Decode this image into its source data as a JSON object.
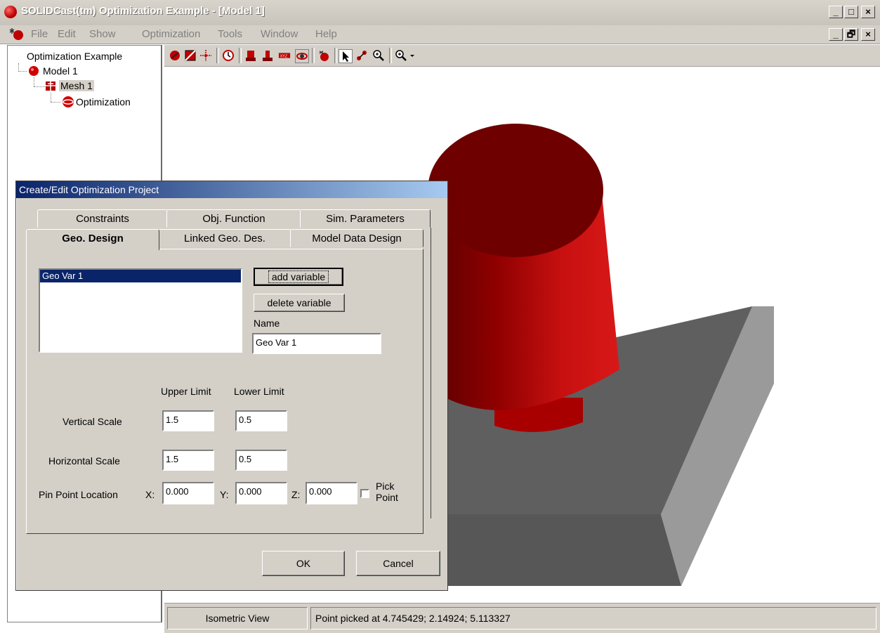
{
  "window": {
    "title": "SOLIDCast(tm) Optimization Example - [Model 1]",
    "controls": [
      "_",
      "□",
      "×"
    ],
    "child_controls": [
      "_",
      "🗗",
      "×"
    ]
  },
  "menu": [
    "File",
    "Edit",
    "Show",
    "Optimization",
    "Tools",
    "Window",
    "Help"
  ],
  "tree": {
    "root": "Optimization Example",
    "model": "Model 1",
    "mesh": "Mesh 1",
    "optimization": "Optimization"
  },
  "toolbar_icons": [
    "sphere-icon",
    "red-square-icon",
    "crosshair-icon",
    "clock-icon",
    "bar-xz-icon",
    "bar-xy-icon",
    "bar-xyz-icon",
    "rotate-icon",
    "apple-icon",
    "pointer-icon",
    "pick-point-icon",
    "zoom-in-icon",
    "zoom-dropdown-icon"
  ],
  "dialog": {
    "title": "Create/Edit Optimization Project",
    "tabs_back": [
      "Constraints",
      "Obj. Function",
      "Sim. Parameters"
    ],
    "tabs_front": [
      "Geo. Design",
      "Linked Geo. Des.",
      "Model Data Design"
    ],
    "list_items": [
      "Geo Var 1"
    ],
    "add_variable": "add variable",
    "delete_variable": "delete variable",
    "name_label": "Name",
    "name_value": "Geo Var 1",
    "upper_limit": "Upper Limit",
    "lower_limit": "Lower Limit",
    "vertical_scale": "Vertical Scale",
    "vertical_upper": "1.5",
    "vertical_lower": "0.5",
    "horizontal_scale": "Horizontal Scale",
    "horizontal_upper": "1.5",
    "horizontal_lower": "0.5",
    "pin_point": "Pin Point Location",
    "x_label": "X:",
    "y_label": "Y:",
    "z_label": "Z:",
    "x_value": "0.000",
    "y_value": "0.000",
    "z_value": "0.000",
    "pick_point_line1": "Pick",
    "pick_point_line2": "Point",
    "ok": "OK",
    "cancel": "Cancel"
  },
  "status": {
    "view": "Isometric View",
    "message": "Point picked at 4.745429; 2.14924; 5.113327"
  },
  "colors": {
    "model_red": "#b00000",
    "plate_gray": "#6e6e6e",
    "selection": "#0a246a"
  }
}
